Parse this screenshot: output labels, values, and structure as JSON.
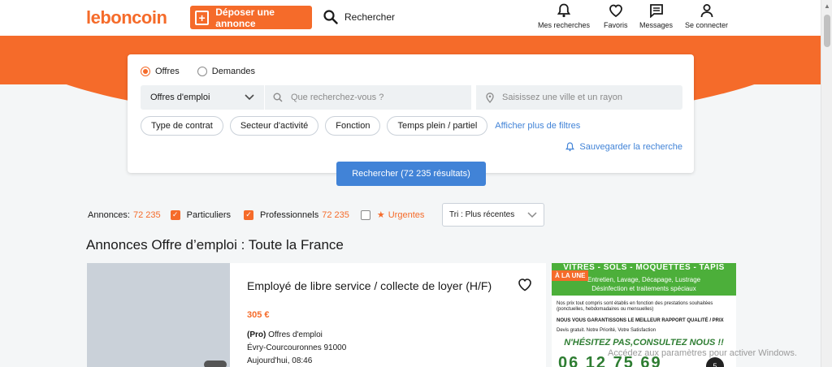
{
  "header": {
    "logo": "leboncoin",
    "post_button": "Déposer une annonce",
    "search_link": "Rechercher",
    "nav": [
      {
        "label": "Mes recherches",
        "icon": "bell-icon"
      },
      {
        "label": "Favoris",
        "icon": "heart-icon"
      },
      {
        "label": "Messages",
        "icon": "message-icon"
      },
      {
        "label": "Se connecter",
        "icon": "user-icon"
      }
    ]
  },
  "search": {
    "radios": [
      {
        "label": "Offres",
        "selected": true
      },
      {
        "label": "Demandes",
        "selected": false
      }
    ],
    "category": "Offres d'emploi",
    "query_placeholder": "Que recherchez-vous ?",
    "location_placeholder": "Saisissez une ville et un rayon",
    "chips": [
      "Type de contrat",
      "Secteur d'activité",
      "Fonction",
      "Temps plein / partiel"
    ],
    "more_filters": "Afficher plus de filtres",
    "save_search": "Sauvegarder la recherche",
    "submit": "Rechercher (72 235 résultats)"
  },
  "filter_bar": {
    "annonces_label": "Annonces:",
    "annonces_count": "72 235",
    "particuliers_label": "Particuliers",
    "particuliers_checked": true,
    "professionnels_label": "Professionnels",
    "professionnels_count": "72 235",
    "professionnels_checked": true,
    "urgentes_label": "Urgentes",
    "urgentes_checked": false,
    "sort": "Tri : Plus récentes"
  },
  "page_title": "Annonces Offre d’emploi : Toute la France",
  "listing": {
    "title": "Employé de libre service / collecte de loyer (H/F)",
    "price": "305 €",
    "pro_tag": "(Pro)",
    "category": "Offres d'emploi",
    "location": "Évry-Courcouronnes 91000",
    "date": "Aujourd'hui, 08:46"
  },
  "ad": {
    "flag": "À LA UNE",
    "headline": "VITRES  -  SOLS  -  MOQUETTES  -  TAPIS",
    "line1": "Entretien, Lavage, Décapage, Lustrage",
    "line2": "Désinfection et traitements spéciaux",
    "body1": "Nos prix tout compris sont établis en fonction des prestations souhaitées (ponctuelles, hebdomadaires ou mensuelles)",
    "body2": "NOUS VOUS GARANTISSONS LE MEILLEUR RAPPORT QUALITÉ / PRIX",
    "body3": "Devis gratuit. Notre Priorité, Votre Satisfaction",
    "cta": "N'HÉSITEZ PAS,CONSULTEZ NOUS !!",
    "number": "06 12 75 69",
    "circle": "5"
  },
  "watermark": "Accédez aux paramètres pour activer Windows.",
  "colors": {
    "brand": "#f56b2a",
    "link": "#4183d7",
    "ad_green": "#4caf3a"
  }
}
